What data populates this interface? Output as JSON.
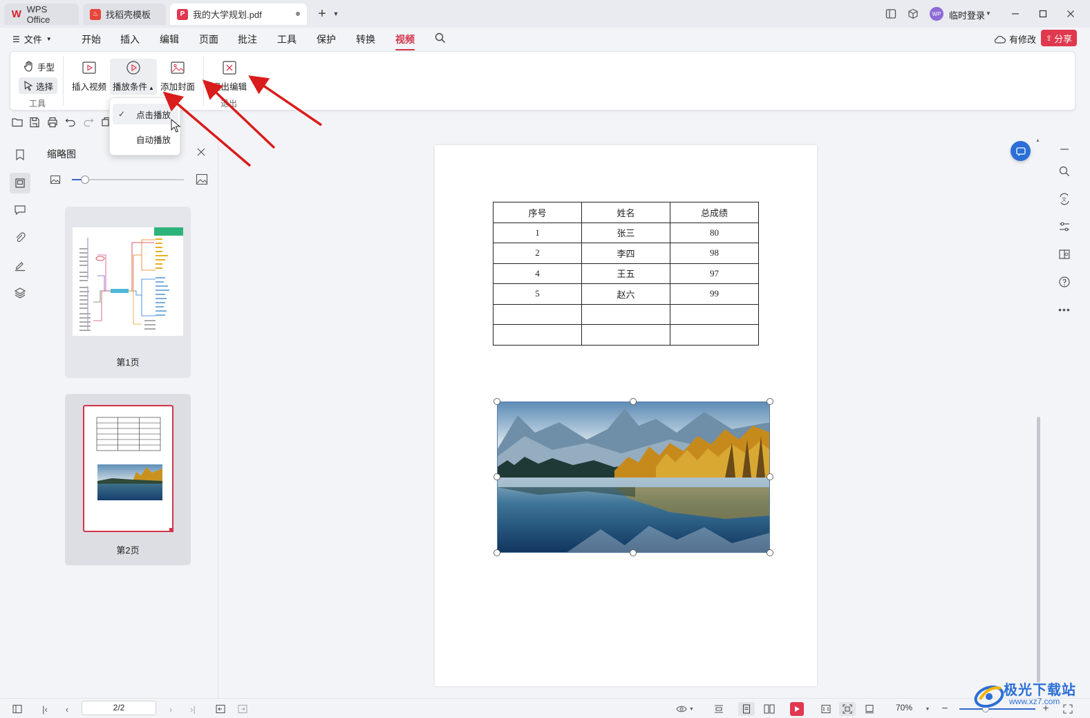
{
  "tabs": [
    {
      "label": "WPS Office",
      "icon": "wps-logo-icon"
    },
    {
      "label": "找稻壳模板",
      "icon": "docer-icon"
    },
    {
      "label": "我的大学规划.pdf",
      "icon": "pdf-icon"
    }
  ],
  "titlebar": {
    "user_badge": "WP",
    "user_label": "临时登录"
  },
  "menu": {
    "file": "文件",
    "items": [
      "开始",
      "插入",
      "编辑",
      "页面",
      "批注",
      "工具",
      "保护",
      "转换",
      "视频"
    ],
    "active": "视频",
    "modified": "有修改",
    "share": "分享"
  },
  "ribbon": {
    "hand": "手型",
    "select": "选择",
    "tools_group": "工具",
    "insert_video": "插入视频",
    "play_condition": "播放条件",
    "add_cover": "添加封面",
    "exit_edit": "退出编辑",
    "exit_group": "退出"
  },
  "dropdown": {
    "items": [
      "点击播放",
      "自动播放"
    ],
    "checked": "点击播放"
  },
  "thumbnails": {
    "title": "缩略图",
    "zoom_fraction": 0.12,
    "pages": [
      {
        "label": "第1页"
      },
      {
        "label": "第2页"
      }
    ]
  },
  "table": {
    "headers": [
      "序号",
      "姓名",
      "总成绩"
    ],
    "rows": [
      [
        "1",
        "张三",
        "80"
      ],
      [
        "2",
        "李四",
        "98"
      ],
      [
        "4",
        "王五",
        "97"
      ],
      [
        "5",
        "赵六",
        "99"
      ],
      [
        "",
        "",
        ""
      ],
      [
        "",
        "",
        ""
      ]
    ]
  },
  "status": {
    "page_input": "2/2",
    "zoom": "70%"
  },
  "watermark": {
    "brand": "极光下载站",
    "url": "www.xz7.com"
  },
  "colors": {
    "accent": "#d1334a",
    "share": "#e0384f",
    "arrow": "#d91c1c",
    "brand_blue": "#2b6fd6"
  }
}
